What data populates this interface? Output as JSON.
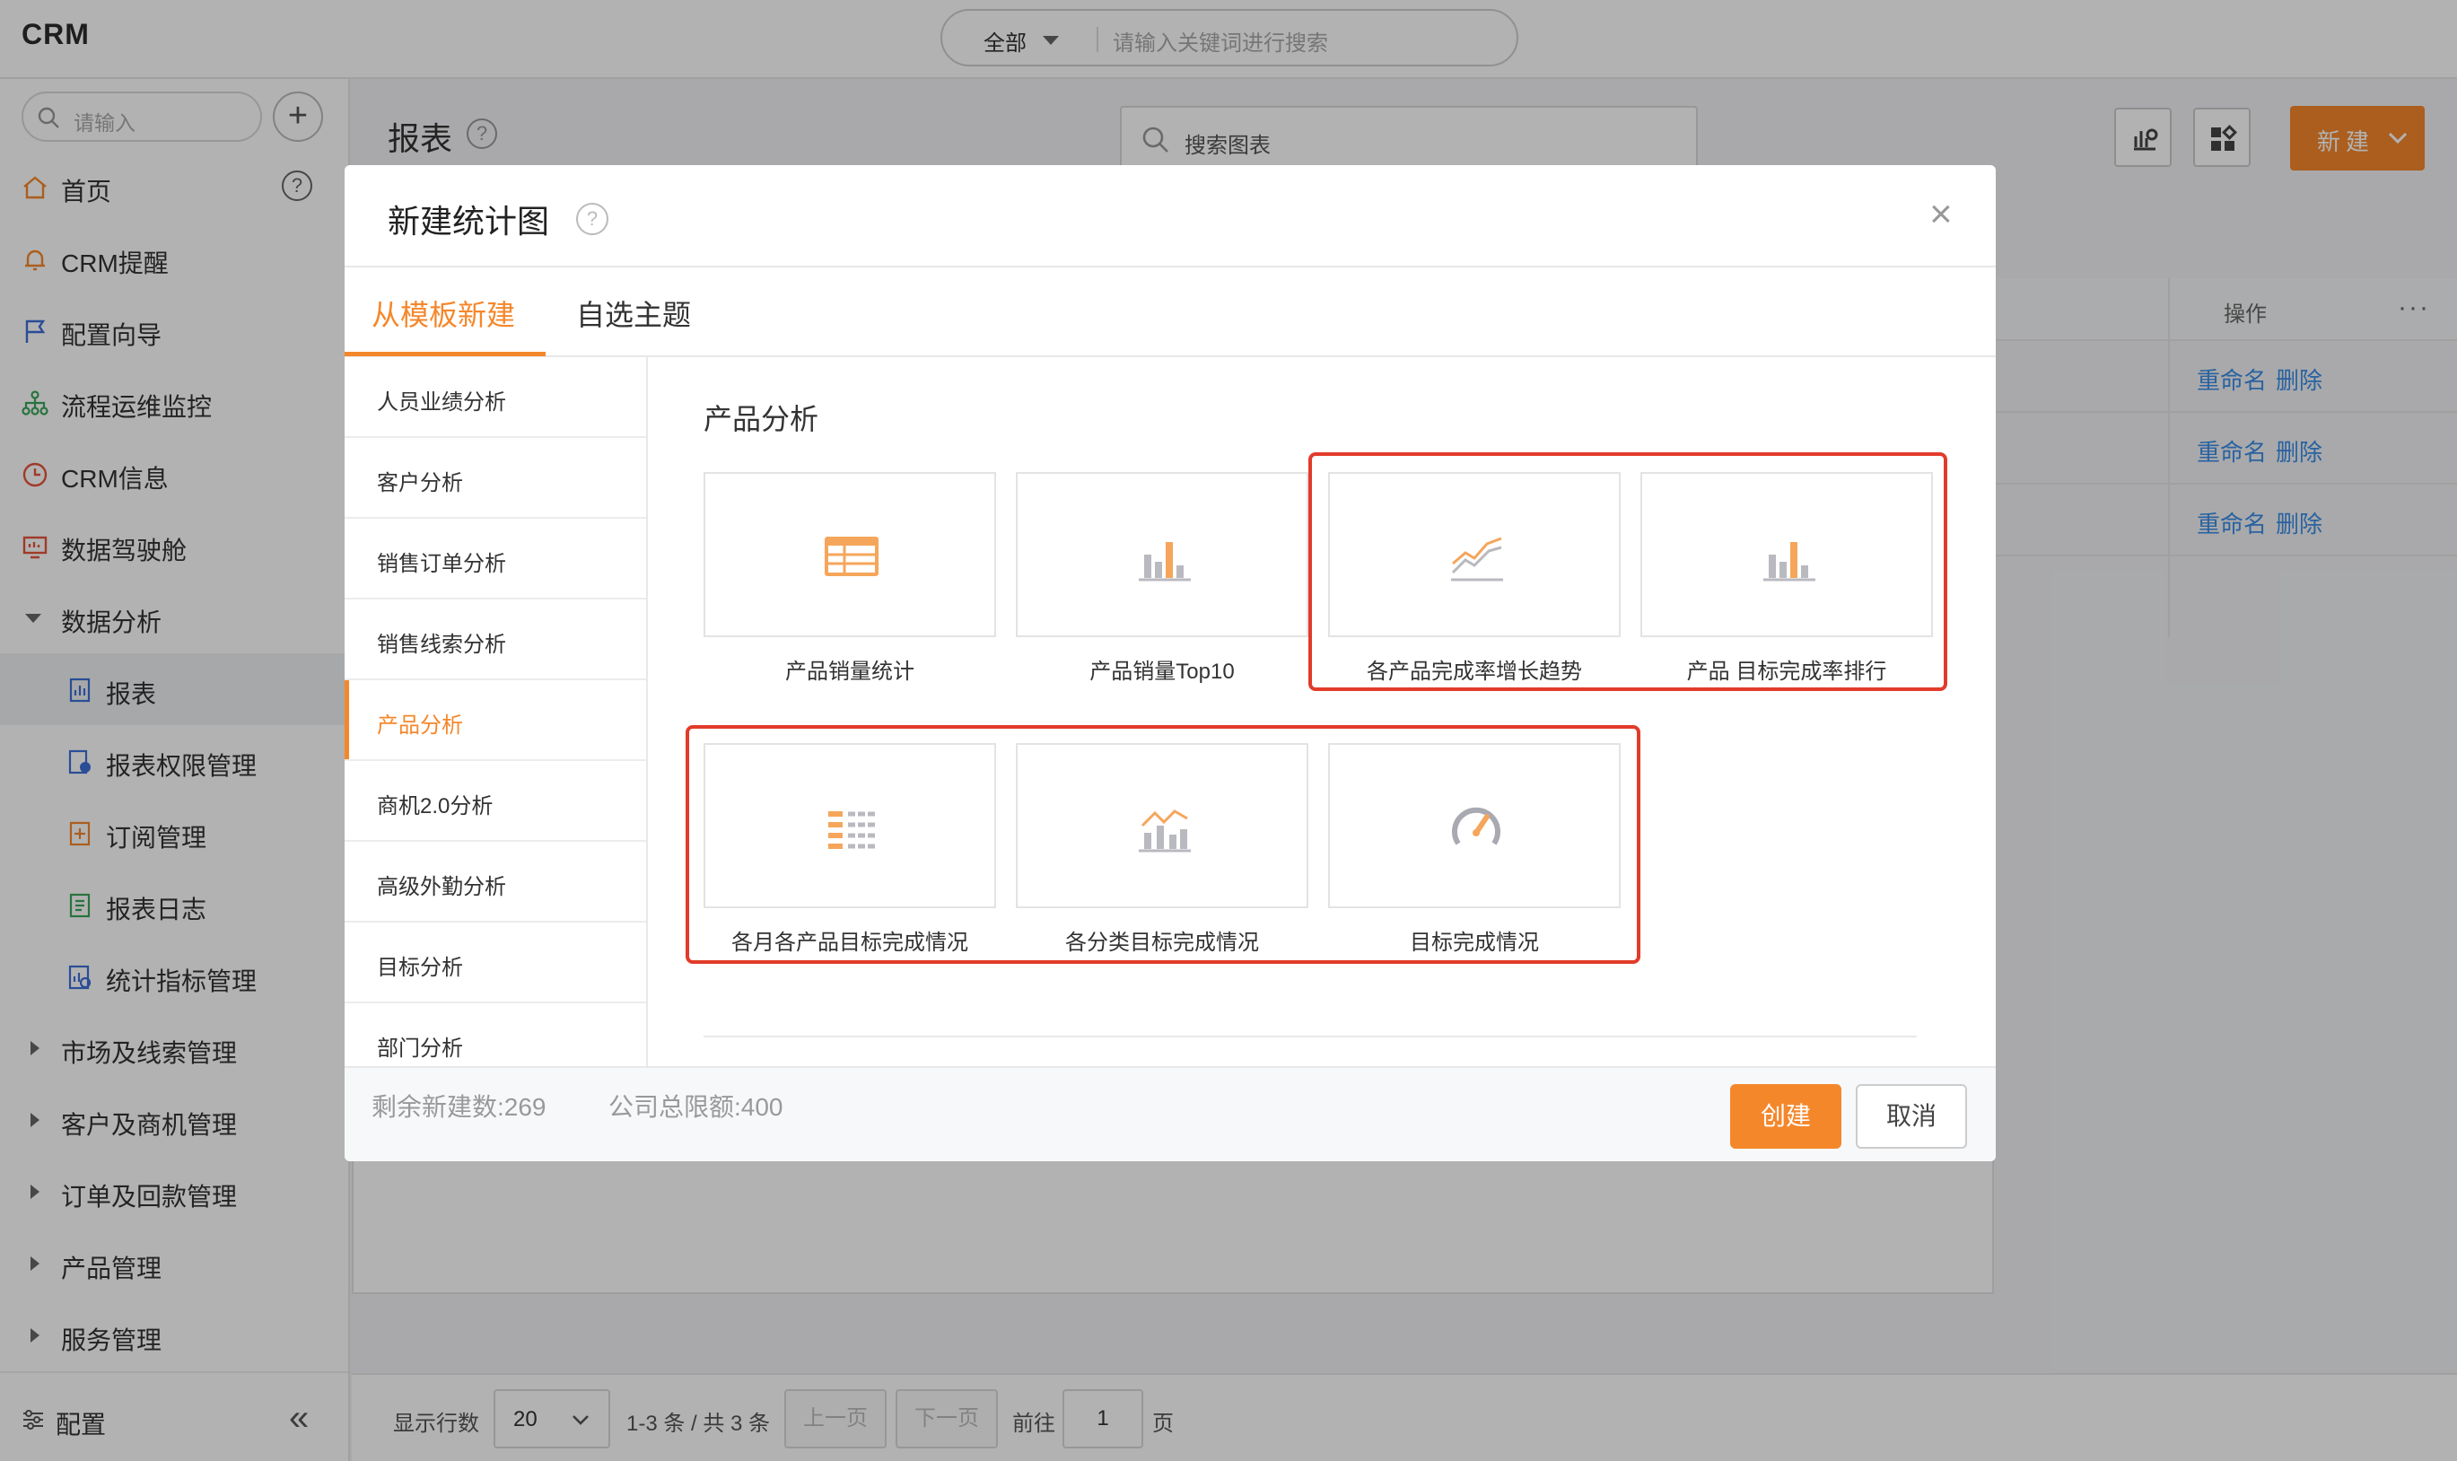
{
  "app": {
    "logo": "CRM"
  },
  "global_search": {
    "scope": "全部",
    "placeholder": "请输入关键词进行搜索"
  },
  "sidebar": {
    "search_placeholder": "请输入",
    "add_symbol": "+",
    "help_symbol": "?",
    "items": [
      {
        "label": "首页",
        "icon": "home-icon"
      },
      {
        "label": "CRM提醒",
        "icon": "bell-icon"
      },
      {
        "label": "配置向导",
        "icon": "flag-icon"
      },
      {
        "label": "流程运维监控",
        "icon": "org-tree-icon"
      },
      {
        "label": "CRM信息",
        "icon": "clock-icon"
      },
      {
        "label": "数据驾驶舱",
        "icon": "monitor-icon"
      },
      {
        "label": "数据分析",
        "icon": "caret-down-icon"
      },
      {
        "label": "报表",
        "icon": "report-icon"
      },
      {
        "label": "报表权限管理",
        "icon": "report-permission-icon"
      },
      {
        "label": "订阅管理",
        "icon": "subscription-icon"
      },
      {
        "label": "报表日志",
        "icon": "log-icon"
      },
      {
        "label": "统计指标管理",
        "icon": "metric-icon"
      },
      {
        "label": "市场及线索管理",
        "icon": "caret-right-icon"
      },
      {
        "label": "客户及商机管理",
        "icon": "caret-right-icon"
      },
      {
        "label": "订单及回款管理",
        "icon": "caret-right-icon"
      },
      {
        "label": "产品管理",
        "icon": "caret-right-icon"
      },
      {
        "label": "服务管理",
        "icon": "caret-right-icon"
      }
    ],
    "footer_label": "配置",
    "collapse_symbol": "«"
  },
  "main": {
    "title": "报表",
    "help_symbol": "?",
    "chart_search_placeholder": "搜索图表",
    "new_button": "新建",
    "table": {
      "ops_header": "操作",
      "more": "···",
      "rows": [
        {
          "rename": "重命名",
          "delete": "删除"
        },
        {
          "rename": "重命名",
          "delete": "删除"
        },
        {
          "rename": "重命名",
          "delete": "删除"
        }
      ]
    },
    "pager": {
      "rows_label": "显示行数",
      "rows_value": "20",
      "range": "1-3 条 / 共 3 条",
      "prev": "上一页",
      "next": "下一页",
      "goto": "前往",
      "page": "1",
      "page_unit": "页"
    }
  },
  "dialog": {
    "title": "新建统计图",
    "help_symbol": "?",
    "close_symbol": "×",
    "tabs": [
      "从模板新建",
      "自选主题"
    ],
    "categories": [
      "人员业绩分析",
      "客户分析",
      "销售订单分析",
      "销售线索分析",
      "产品分析",
      "商机2.0分析",
      "高级外勤分析",
      "目标分析",
      "部门分析"
    ],
    "active_category": "产品分析",
    "section_title": "产品分析",
    "templates": [
      {
        "label": "产品销量统计",
        "icon": "table-icon"
      },
      {
        "label": "产品销量Top10",
        "icon": "bar-chart-icon"
      },
      {
        "label": "各产品完成率增长趋势",
        "icon": "line-chart-icon"
      },
      {
        "label": "产品 目标完成率排行",
        "icon": "bar-chart-icon"
      },
      {
        "label": "各月各产品目标完成情况",
        "icon": "list-grid-icon"
      },
      {
        "label": "各分类目标完成情况",
        "icon": "bar-line-combo-icon"
      },
      {
        "label": "目标完成情况",
        "icon": "gauge-icon"
      }
    ],
    "footer": {
      "remaining": "剩余新建数:269",
      "company_limit": "公司总限额:400",
      "create": "创建",
      "cancel": "取消"
    },
    "colors": {
      "accent": "#f5872b",
      "highlight": "#e23b2a",
      "link": "#3b8de6"
    }
  }
}
